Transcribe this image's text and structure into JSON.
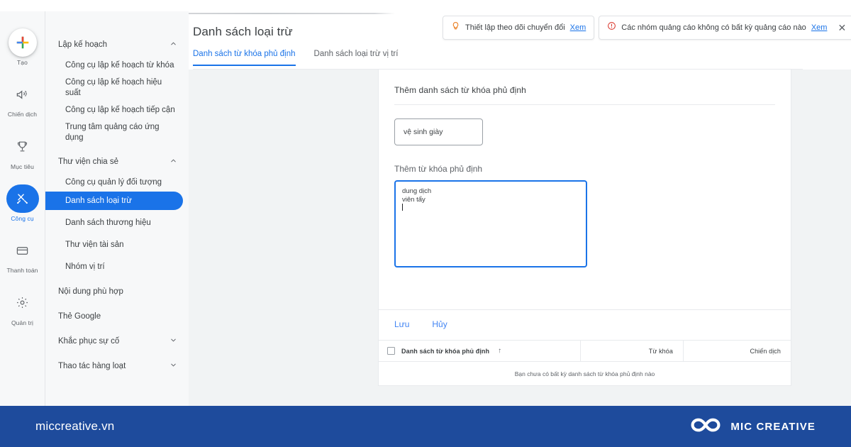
{
  "app": {
    "page_title": "Danh sách loại trừ",
    "tabs": [
      {
        "label": "Danh sách từ khóa phủ định",
        "active": true
      },
      {
        "label": "Danh sách loại trừ vị trí",
        "active": false
      }
    ]
  },
  "rail": {
    "items": [
      {
        "label": "Tạo",
        "icon": "plus-icon",
        "active": false
      },
      {
        "label": "Chiến dịch",
        "icon": "megaphone-icon",
        "active": false
      },
      {
        "label": "Mục tiêu",
        "icon": "trophy-icon",
        "active": false
      },
      {
        "label": "Công cụ",
        "icon": "tools-icon",
        "active": true
      },
      {
        "label": "Thanh toán",
        "icon": "credit-card-icon",
        "active": false
      },
      {
        "label": "Quản trị",
        "icon": "gear-icon",
        "active": false
      }
    ]
  },
  "sidebar": {
    "groups": [
      {
        "title": "Lập kế hoạch",
        "chevron": "chevron-up-icon",
        "items": [
          "Công cụ lập kế hoạch từ khóa",
          "Công cụ lập kế hoạch hiệu suất",
          "Công cụ lập kế hoạch tiếp cận",
          "Trung tâm quảng cáo ứng dụng"
        ]
      },
      {
        "title": "Thư viện chia sẻ",
        "chevron": "chevron-up-icon",
        "items": [
          "Công cụ quản lý đối tượng",
          "Danh sách loại trừ",
          "Danh sách thương hiệu",
          "Thư viện tài sản",
          "Nhóm vị trí"
        ],
        "active_item": "Danh sách loại trừ"
      }
    ],
    "standalone": [
      {
        "label": "Nội dung phù hợp",
        "chevron": null
      },
      {
        "label": "Thẻ Google",
        "chevron": null
      },
      {
        "label": "Khắc phục sự cố",
        "chevron": "chevron-down-icon"
      },
      {
        "label": "Thao tác hàng loạt",
        "chevron": "chevron-down-icon"
      }
    ]
  },
  "notifications": [
    {
      "icon": "lightbulb-icon",
      "icon_color": "#e8710a",
      "text": "Thiết lập theo dõi chuyển đổi",
      "link": "Xem",
      "closable": false
    },
    {
      "icon": "error-circle-icon",
      "icon_color": "#d93025",
      "text": "Các nhóm quảng cáo không có bất kỳ quảng cáo nào",
      "link": "Xem",
      "close_label": "✕",
      "closable": true
    }
  ],
  "form": {
    "title": "Thêm danh sách từ khóa phủ định",
    "list_name_value": "vệ sinh giày",
    "keywords_label": "Thêm từ khóa phủ định",
    "keywords_lines": [
      "dung dịch",
      "viên tẩy"
    ],
    "save_label": "Lưu",
    "cancel_label": "Hủy"
  },
  "table": {
    "columns": [
      {
        "label": "Danh sách từ khóa phủ định",
        "sort": "↑"
      },
      {
        "label": "Từ khóa"
      },
      {
        "label": "Chiến dịch"
      }
    ],
    "empty_message": "Bạn chưa có bất kỳ danh sách từ khóa phủ định nào"
  },
  "footer": {
    "url": "miccreative.vn",
    "brand": "MIC CREATIVE",
    "logo": "infinity-logo-icon",
    "background": "#1e4b9c"
  },
  "colors": {
    "accent": "#1a73e8",
    "link": "#4285f4",
    "workspace_bg": "#f1f3f4",
    "sidebar_bg": "#f7f8f9"
  }
}
